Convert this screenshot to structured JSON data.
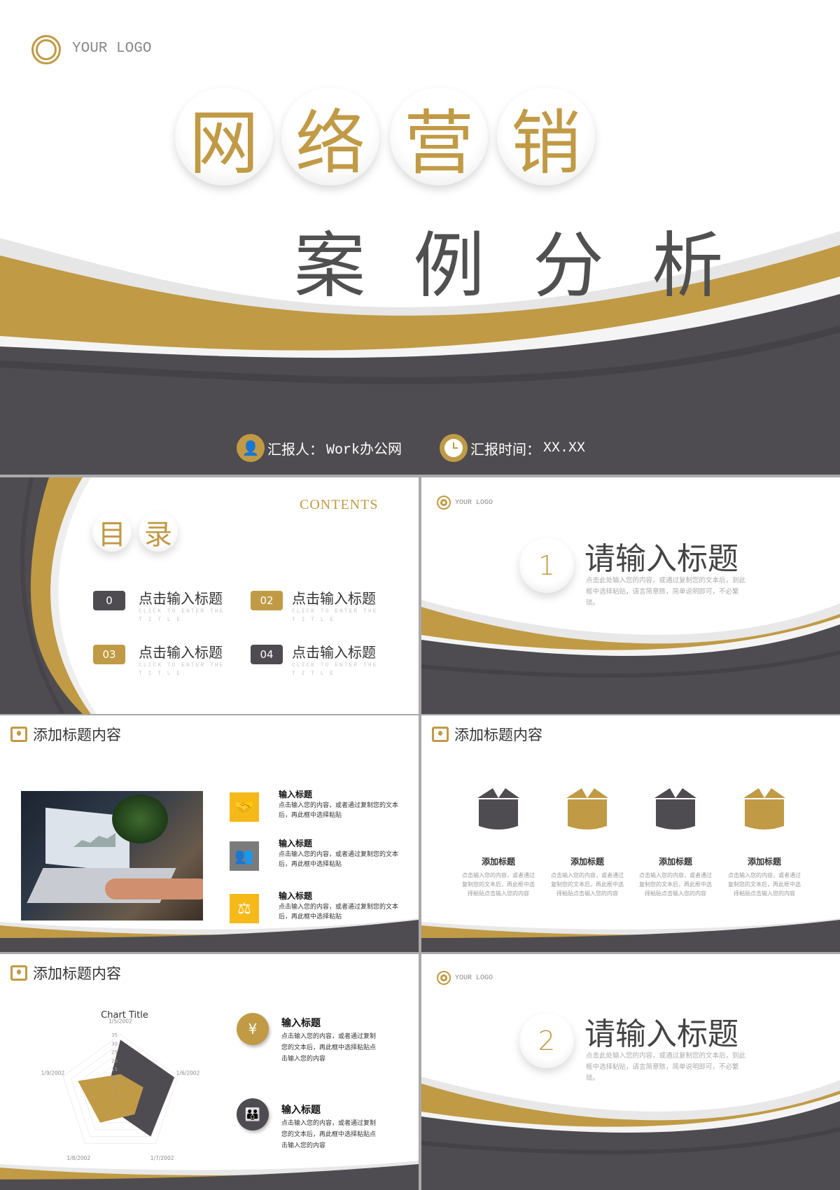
{
  "colors": {
    "gold": "#c09a45",
    "dark": "#4e4c50",
    "yellow": "#f6b91a",
    "grey": "#7b7b7b"
  },
  "cover": {
    "logo": "YOUR LOGO",
    "title_chars": [
      "网",
      "络",
      "营",
      "销"
    ],
    "subtitle": "案 例 分 析",
    "reporter_label": "汇报人：",
    "reporter_value": "Work办公网",
    "time_label": "汇报时间：",
    "time_value": "XX.XX",
    "icons": [
      "person-icon",
      "clock-icon"
    ]
  },
  "toc": {
    "heading_chars": [
      "目",
      "录"
    ],
    "contents_label": "CONTENTS",
    "items": [
      {
        "num": "0",
        "title": "点击输入标题",
        "sub": "CLICK TO ENTER THE T I T L E"
      },
      {
        "num": "02",
        "title": "点击输入标题",
        "sub": "CLICK TO ENTER THE T I T L E"
      },
      {
        "num": "03",
        "title": "点击输入标题",
        "sub": "CLICK TO ENTER THE T I T L E"
      },
      {
        "num": "04",
        "title": "点击输入标题",
        "sub": "CLICK TO ENTER THE T I T L E"
      }
    ]
  },
  "section1": {
    "logo": "YOUR LOGO",
    "num": "1",
    "title": "请输入标题",
    "desc": "点击此处输入您的内容，或通过复制您的文本后，到此框中选择粘贴，请言简意赅，简单说明即可，不必繁琐。"
  },
  "slide_photo": {
    "header": "添加标题内容",
    "items": [
      {
        "icon": "handshake-icon",
        "title": "输入标题",
        "desc": "点击输入您的内容，或者通过复制您的文本后，再此框中选择粘贴"
      },
      {
        "icon": "meeting-icon",
        "title": "输入标题",
        "desc": "点击输入您的内容，或者通过复制您的文本后，再此框中选择粘贴"
      },
      {
        "icon": "balance-icon",
        "title": "输入标题",
        "desc": "点击输入您的内容，或者通过复制您的文本后，再此框中选择粘贴"
      }
    ]
  },
  "slide_boxes": {
    "header": "添加标题内容",
    "items": [
      {
        "title": "添加标题",
        "desc": "点击输入您的内容，或者通过复制您的文本后，再此框中选择粘贴点击输入您的内容"
      },
      {
        "title": "添加标题",
        "desc": "点击输入您的内容，或者通过复制您的文本后，再此框中选择粘贴点击输入您的内容"
      },
      {
        "title": "添加标题",
        "desc": "点击输入您的内容，或者通过复制您的文本后，再此框中选择粘贴点击输入您的内容"
      },
      {
        "title": "添加标题",
        "desc": "点击输入您的内容，或者通过复制您的文本后，再此框中选择粘贴点击输入您的内容"
      }
    ]
  },
  "slide_chart": {
    "header": "添加标题内容",
    "items": [
      {
        "icon": "money-hand-icon",
        "title": "输入标题",
        "desc": "点击输入您的内容，或者通过复制您的文本后，再此框中选择粘贴点击输入您的内容"
      },
      {
        "icon": "team-icon",
        "title": "输入标题",
        "desc": "点击输入您的内容，或者通过复制您的文本后，再此框中选择粘贴点击输入您的内容"
      }
    ]
  },
  "chart_data": {
    "type": "radar",
    "title": "Chart Title",
    "categories": [
      "1/5/2002",
      "1/6/2002",
      "1/7/2002",
      "1/8/2002",
      "1/9/2002"
    ],
    "ticks": [
      0,
      5,
      10,
      15,
      20,
      25,
      30,
      35
    ],
    "rlim": [
      0,
      35
    ],
    "series": [
      {
        "values": [
          32,
          33,
          30,
          10,
          8
        ],
        "color": "#4e4c50"
      },
      {
        "values": [
          12,
          14,
          14,
          20,
          26
        ],
        "color": "#c09a45"
      }
    ]
  },
  "section2": {
    "logo": "YOUR LOGO",
    "num": "2",
    "title": "请输入标题",
    "desc": "点击此处输入您的内容，或通过复制您的文本后，到此框中选择粘贴，请言简意赅，简单说明即可，不必繁琐。"
  }
}
